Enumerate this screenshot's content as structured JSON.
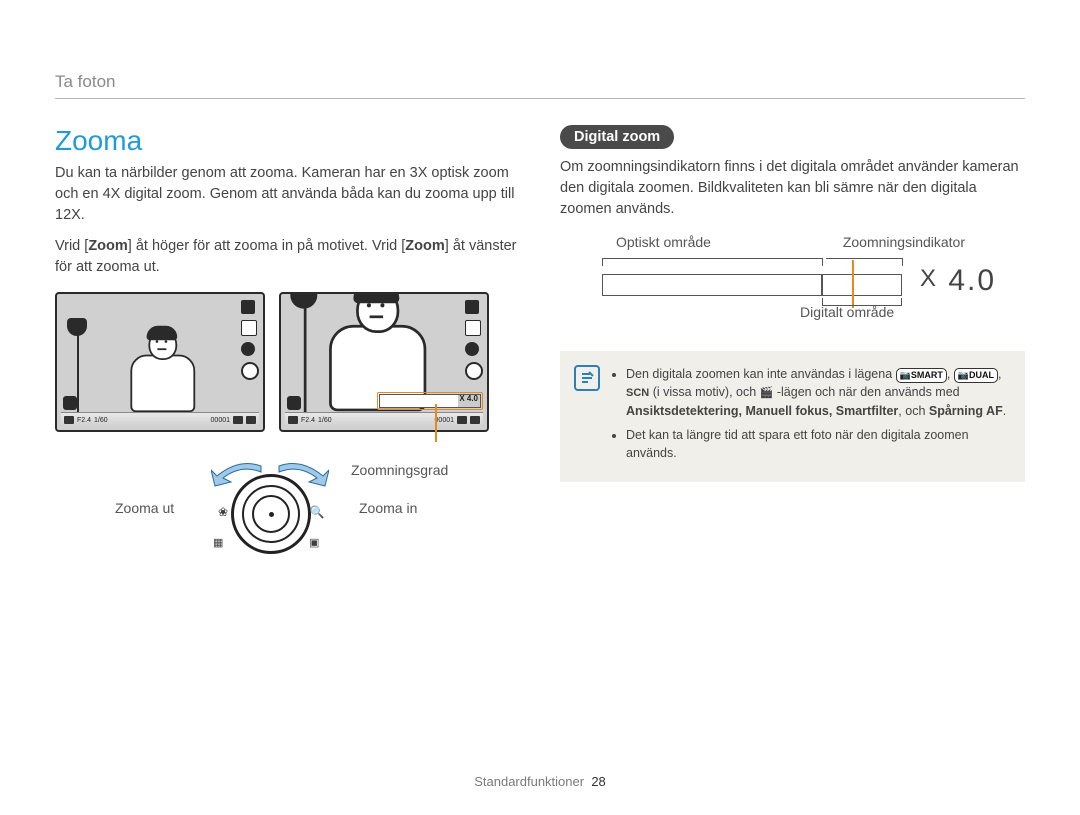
{
  "breadcrumb": "Ta foton",
  "left": {
    "heading": "Zooma",
    "p1": "Du kan ta närbilder genom att zooma. Kameran har en 3X optisk zoom och en 4X digital zoom. Genom att använda båda kan du zooma upp till 12X.",
    "p2_pre": "Vrid [",
    "p2_kw1": "Zoom",
    "p2_mid": "] åt höger för att zooma in på motivet. Vrid [",
    "p2_kw2": "Zoom",
    "p2_post": "] åt vänster för att zooma ut.",
    "thumb_info": {
      "aperture": "F2.4",
      "shutter": "1/60",
      "counter": "00001",
      "zoom_overlay": "X 4.0"
    },
    "labels": {
      "zoom_grade": "Zoomningsgrad",
      "zoom_out": "Zooma ut",
      "zoom_in": "Zooma in"
    }
  },
  "right": {
    "pill": "Digital zoom",
    "p1": "Om zoomningsindikatorn finns i det digitala området använder kameran den digitala zoomen. Bildkvaliteten kan bli sämre när den digitala zoomen används.",
    "diagram": {
      "optical_label": "Optiskt område",
      "indicator_label": "Zoomningsindikator",
      "digital_label": "Digitalt område",
      "zoom_text": "4.0",
      "zoom_prefix": "X"
    },
    "note": {
      "bullet1_pre": "Den digitala zoomen kan inte användas i lägena ",
      "bullet1_mode_smart": "SMART",
      "bullet1_mode_dual": "DUAL",
      "bullet1_scn": "SCN",
      "bullet1_mid": " (i vissa motiv), och ",
      "bullet1_movie": "🎬",
      "bullet1_post": " -lägen och när den används med ",
      "features_list": "Ansiktsdetektering, Manuell fokus, Smartfilter",
      "and_word": ", och ",
      "tracking_af": "Spårning AF",
      "period": ".",
      "bullet2": "Det kan ta längre tid att spara ett foto när den digitala zoomen används."
    }
  },
  "footer": {
    "section": "Standardfunktioner",
    "page_number": "28"
  }
}
